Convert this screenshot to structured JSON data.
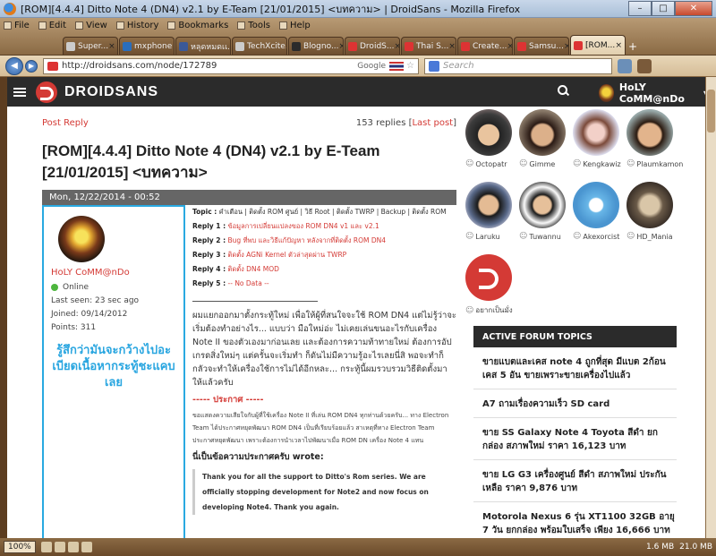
{
  "window": {
    "title": "[ROM][4.4.4] Ditto Note 4 (DN4) v2.1 by E-Team [21/01/2015] <บทความ> | DroidSans - Mozilla Firefox"
  },
  "menu": [
    "File",
    "Edit",
    "View",
    "History",
    "Bookmarks",
    "Tools",
    "Help"
  ],
  "tabs": [
    {
      "label": "Super...",
      "icon": "gray"
    },
    {
      "label": "mxphone |",
      "icon": "blue"
    },
    {
      "label": "หลุดหมดเเ...",
      "icon": "fb"
    },
    {
      "label": "TechXcite.c...",
      "icon": "gray"
    },
    {
      "label": "Blogno...",
      "icon": "dn"
    },
    {
      "label": "DroidS...",
      "icon": "red"
    },
    {
      "label": "Thai S...",
      "icon": "red"
    },
    {
      "label": "Create...",
      "icon": "red"
    },
    {
      "label": "Samsu...",
      "icon": "red"
    },
    {
      "label": "[ROM...",
      "icon": "red",
      "active": true
    }
  ],
  "nav": {
    "url": "http://droidsans.com/node/172789",
    "google_label": "Google",
    "search_placeholder": "Search"
  },
  "site": {
    "brand": "DROIDSANS",
    "user": "HoLY CoMM@nDo"
  },
  "post": {
    "post_reply": "Post Reply",
    "replies_count": "153 replies [",
    "last_post": "Last post",
    "replies_close": "]",
    "title": "[ROM][4.4.4] Ditto Note 4 (DN4) v2.1 by E-Team [21/01/2015] <บทความ>",
    "date": "Mon, 12/22/2014 - 00:52"
  },
  "author": {
    "name": "HoLY CoMM@nDo",
    "status": "Online",
    "last_seen": "Last seen: 23 sec ago",
    "joined": "Joined: 09/14/2012",
    "points": "Points: 311",
    "callout": "รู้สึกว่ามันจะกว้างไปอะ เบียดเนื้อหากระทู้ชะแคบเลย"
  },
  "body": {
    "topic_label": "Topic :",
    "topic_text": " คำเตือน | ติดตั้ง ROM ศูนย์ | วิธี Root | ติดตั้ง TWRP | Backup | ติดตั้ง ROM",
    "replies": [
      {
        "label": "Reply 1 :",
        "text": " ข้อมูลการเปลี่ยนแปลงของ ROM DN4 v1 และ v2.1"
      },
      {
        "label": "Reply 2 :",
        "text": " Bug ที่พบ และวิธีแก้ปัญหา หลังจากที่ติดตั้ง ROM DN4"
      },
      {
        "label": "Reply 3 :",
        "text": " ติดตั้ง AGNi Kernel ตัวล่าสุดผ่าน TWRP"
      },
      {
        "label": "Reply 4 :",
        "text": " ติดตั้ง DN4 MOD"
      },
      {
        "label": "Reply 5 :",
        "text": " -- No Data --"
      }
    ],
    "para": "ผมแยกออกมาตั้งกระทู้ใหม่ เพื่อให้ผู้ที่สนใจจะใช้ ROM DN4 แต่ไม่รู้ว่าจะเริ่มต้องทำอย่างไร... แบบว่า มือใหม่อ่ะ ไม่เคยเล่นขนอะไรกับเครื่อง Note II ของตัวเองมาก่อนเลย และต้องการความท้าทายใหม่ ต้องการอัปเกรดสิ่งใหม่ๆ แต่ครั้นจะเริ่มทำ ก็ดันไม่มีความรู้อะไรเลยนี่สิ พอจะทำก็กลัวจะทำให้เครื่องใช้การไม่ได้อีกหละ... กระทู้นี้ผมรวบรวมวิธีติดตั้งมาให้แล้วครับ",
    "announce": "----- ประกาศ -----",
    "small": "ขอแสดงความเสียใจกับผู้ที่ใช้เครื่อง Note II ที่เล่น ROM DN4 ทุกท่านด้วยครับ... ทาง Electron Team ได้ประกาศหยุดพัฒนา ROM DN4 เป็นที่เรียบร้อยแล้ว สาเหตุที่ทาง Electron Team ประกาศหยุดพัฒนา เพราะต้องการนำเวลาไปพัฒนาเมื่อ ROM DN เครื่อง Note 4 แทน",
    "wrote": "นี่เป็นข้อความประกาศครับ wrote:",
    "quote": "Thank you for all the support to Ditto's Rom series. We are officially stopping development for Note2 and now focus on developing Note4. Thank you again."
  },
  "sidebar": {
    "users": [
      {
        "name": "Octopatr"
      },
      {
        "name": "Gimme"
      },
      {
        "name": "Kengkawiz"
      },
      {
        "name": "Plaumkamon"
      },
      {
        "name": "Laruku"
      },
      {
        "name": "Tuwannu"
      },
      {
        "name": "Akexorcist"
      },
      {
        "name": "HD_Mania"
      }
    ],
    "want": "อยากเป็นมั่ง",
    "forum_title": "ACTIVE FORUM TOPICS",
    "topics": [
      "ขายแบตและเคส note 4 ถูกที่สุด มีแบต 2ก้อน เคส 5 อัน ขายเพราะขายเครื่องไปแล้ว",
      "A7 ถามเรื่องความเร็ว SD card",
      "ขาย SS Galaxy Note 4 Toyota สีดำ ยกกล่อง สภาพใหม่ ราคา 16,123 บาท",
      "ขาย LG G3 เครื่องศูนย์ สีดำ สภาพใหม่ ประกันเหลือ ราคา 9,876 บาท",
      "Motorola Nexus 6 รุ่น XT1100 32GB อายุ 7 วัน ยกกล่อง พร้อมใบเสร็จ เพียง 16,666 บาท"
    ]
  },
  "status": {
    "zoom": "100%",
    "mem1": "1.6 MB",
    "mem2": "21.0 MB"
  }
}
